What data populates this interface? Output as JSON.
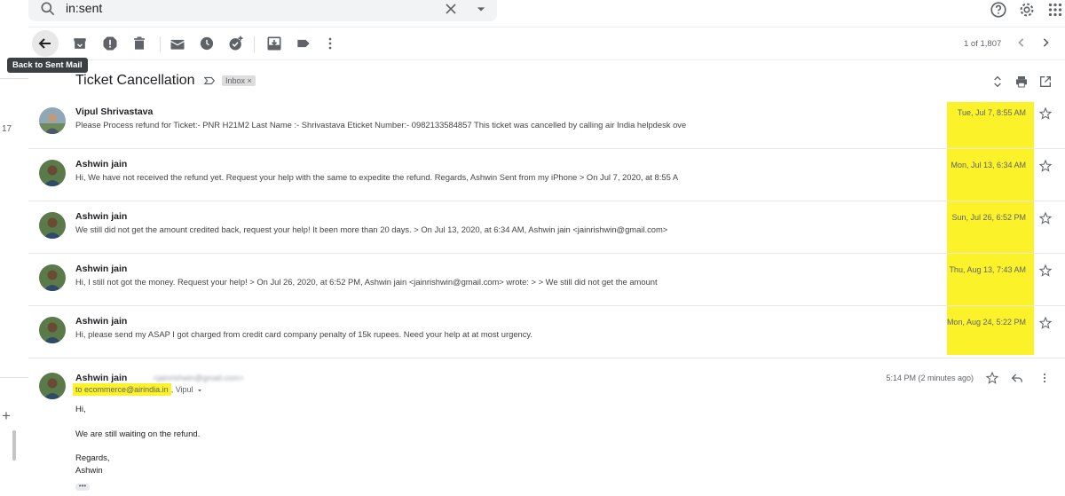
{
  "search": {
    "value": "in:sent"
  },
  "tooltip": "Back to Sent Mail",
  "pager": "1 of 1,807",
  "left": {
    "count": "17"
  },
  "thread": {
    "subject": "Ticket Cancellation",
    "label": "Inbox",
    "label_close": "×"
  },
  "colors": {
    "highlight": "#fbf22a"
  },
  "messages": [
    {
      "sender": "Vipul Shrivastava",
      "snippet": "Please Process refund for Ticket:- PNR H21M2 Last Name :- Shrivastava Eticket Number:- 0982133584857 This ticket was cancelled by calling air India helpdesk ove",
      "date": "Tue, Jul 7, 8:55 AM"
    },
    {
      "sender": "Ashwin jain",
      "snippet": "Hi, We have not received the refund yet. Request your help with the same to expedite the refund. Regards, Ashwin Sent from my iPhone > On Jul 7, 2020, at 8:55 A",
      "date": "Mon, Jul 13, 6:34 AM"
    },
    {
      "sender": "Ashwin jain",
      "snippet": "We still did not get the amount credited back, request your help! It been more than 20 days. > On Jul 13, 2020, at 6:34 AM, Ashwin jain <jainrishwin@gmail.com>",
      "date": "Sun, Jul 26, 6:52 PM"
    },
    {
      "sender": "Ashwin jain",
      "snippet": "Hi, I still not got the money. Request your help! > On Jul 26, 2020, at 6:52 PM, Ashwin jain <jainrishwin@gmail.com> wrote: > > We still did not get the amount",
      "date": "Thu, Aug 13, 7:43 AM"
    },
    {
      "sender": "Ashwin jain",
      "snippet": "Hi, please send my ASAP I got charged from credit card company penalty of 15k rupees. Need your help at at most urgency.",
      "date": "Mon, Aug 24, 5:22 PM"
    }
  ],
  "expanded": {
    "sender": "Ashwin jain",
    "email_blurred": "<jainrishwin@gmail.com>",
    "to_prefix": "to ecommerce@airindia.in",
    "to_rest": ", Vipul",
    "time": "5:14 PM (2 minutes ago)",
    "body": [
      "Hi,",
      "We are still waiting on the refund.",
      "Regards,",
      "Ashwin"
    ],
    "more": "•••"
  }
}
